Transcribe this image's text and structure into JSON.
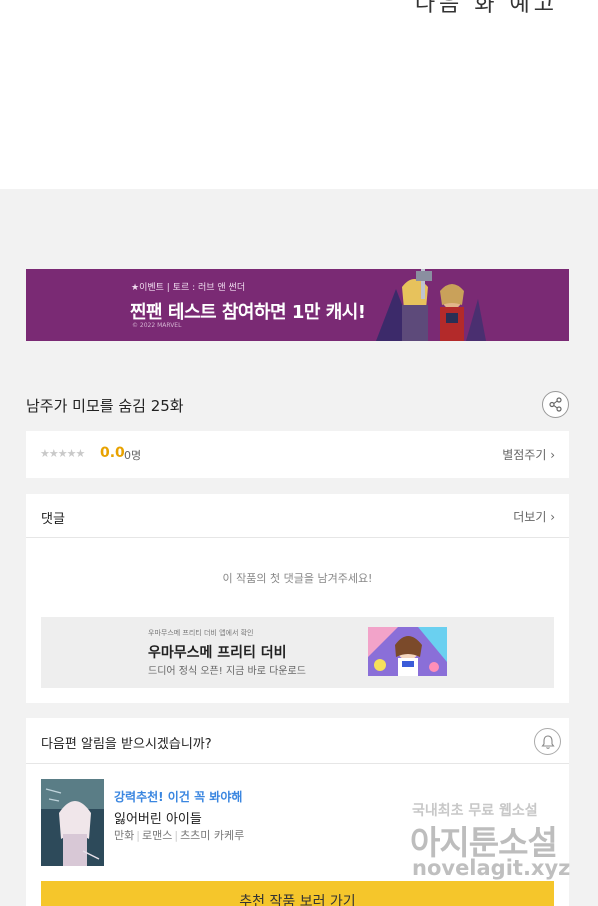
{
  "top": {
    "handwriting": "다음 화 예고"
  },
  "banner": {
    "small": "★이벤트 | 토르 : 러브 앤 썬더",
    "main": "찐팬 테스트 참여하면 1만 캐시!",
    "copyright": "© 2022 MARVEL"
  },
  "episode": {
    "title": "남주가 미모를 숨김 25화"
  },
  "rating": {
    "stars": "★★★★★",
    "score": "0.0",
    "count": "0명",
    "rate_link": "별점주기 ›"
  },
  "comments": {
    "title": "댓글",
    "more_link": "더보기 ›",
    "empty_message": "이 작품의 첫 댓글을 남겨주세요!"
  },
  "ad": {
    "small": "우마무스메 프리티 더비 앱에서 확인",
    "title": "우마무스메 프리티 더비",
    "desc": "드디어 정식 오픈! 지금 바로 다운로드"
  },
  "notify": {
    "question": "다음편 알림을 받으시겠습니까?"
  },
  "recommend": {
    "tag": "강력추천! 이건 꼭 봐야해",
    "title": "잃어버린 아이들",
    "genre1": "만화",
    "genre2": "로맨스",
    "author": "츠츠미 카케루",
    "cta": "추천 작품 보러 가기"
  },
  "watermark": {
    "line1": "국내최초 무료 웹소설",
    "line2": "아지툰소설",
    "line3": "novelagit.xyz"
  },
  "colors": {
    "banner_bg": "#7a2a74",
    "score": "#e8a200",
    "rec_tag": "#3a86e0",
    "cta_bg": "#f5c62b"
  }
}
